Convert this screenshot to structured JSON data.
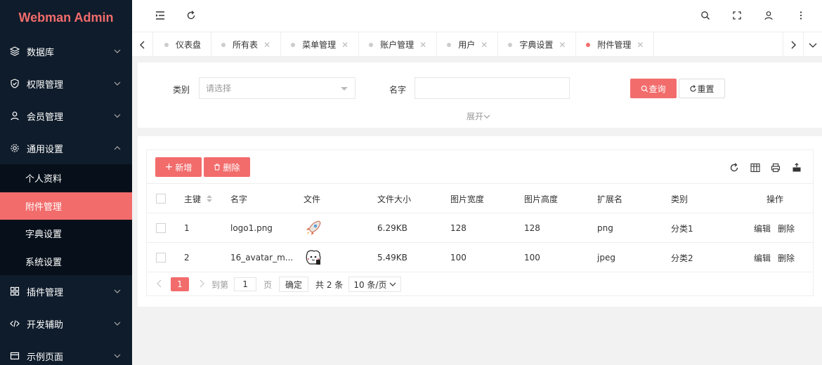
{
  "app": {
    "title": "Webman Admin"
  },
  "colors": {
    "accent": "#f26c6c",
    "sidebar_bg": "#0f1c2b",
    "submenu_bg": "#07101a"
  },
  "sidebar": {
    "items": [
      {
        "label": "数据库",
        "icon": "layers-icon"
      },
      {
        "label": "权限管理",
        "icon": "shield-icon"
      },
      {
        "label": "会员管理",
        "icon": "user-icon"
      },
      {
        "label": "通用设置",
        "icon": "gear-icon",
        "expanded": true,
        "children": [
          "个人资料",
          "附件管理",
          "字典设置",
          "系统设置"
        ],
        "active_child": "附件管理"
      },
      {
        "label": "插件管理",
        "icon": "apps-icon"
      },
      {
        "label": "开发辅助",
        "icon": "code-icon"
      },
      {
        "label": "示例页面",
        "icon": "template-icon"
      }
    ]
  },
  "tabs": [
    {
      "label": "仪表盘",
      "closable": false
    },
    {
      "label": "所有表",
      "closable": true
    },
    {
      "label": "菜单管理",
      "closable": true
    },
    {
      "label": "账户管理",
      "closable": true
    },
    {
      "label": "用户",
      "closable": true
    },
    {
      "label": "字典设置",
      "closable": true
    },
    {
      "label": "附件管理",
      "closable": true,
      "active": true
    }
  ],
  "search": {
    "category_label": "类别",
    "category_placeholder": "请选择",
    "name_label": "名字",
    "name_value": "",
    "query_label": "查询",
    "reset_label": "重置",
    "expand_label": "展开"
  },
  "toolbar": {
    "add_label": "新增",
    "delete_label": "删除"
  },
  "table": {
    "headers": [
      "主键",
      "名字",
      "文件",
      "文件大小",
      "图片宽度",
      "图片高度",
      "扩展名",
      "类别",
      "操作"
    ],
    "rows": [
      {
        "id": "1",
        "name": "logo1.png",
        "file_icon": "rocket-icon",
        "size": "6.29KB",
        "width": "128",
        "height": "128",
        "ext": "png",
        "category": "分类1",
        "edit": "编辑",
        "delete": "删除"
      },
      {
        "id": "2",
        "name": "16_avatar_m...",
        "file_icon": "avatar-icon",
        "size": "5.49KB",
        "width": "100",
        "height": "100",
        "ext": "jpeg",
        "category": "分类2",
        "edit": "编辑",
        "delete": "删除"
      }
    ]
  },
  "pager": {
    "current": "1",
    "goto_label": "到第",
    "goto_value": "1",
    "page_label": "页",
    "confirm_label": "确定",
    "total_label": "共 2 条",
    "size_label": "10 条/页"
  }
}
